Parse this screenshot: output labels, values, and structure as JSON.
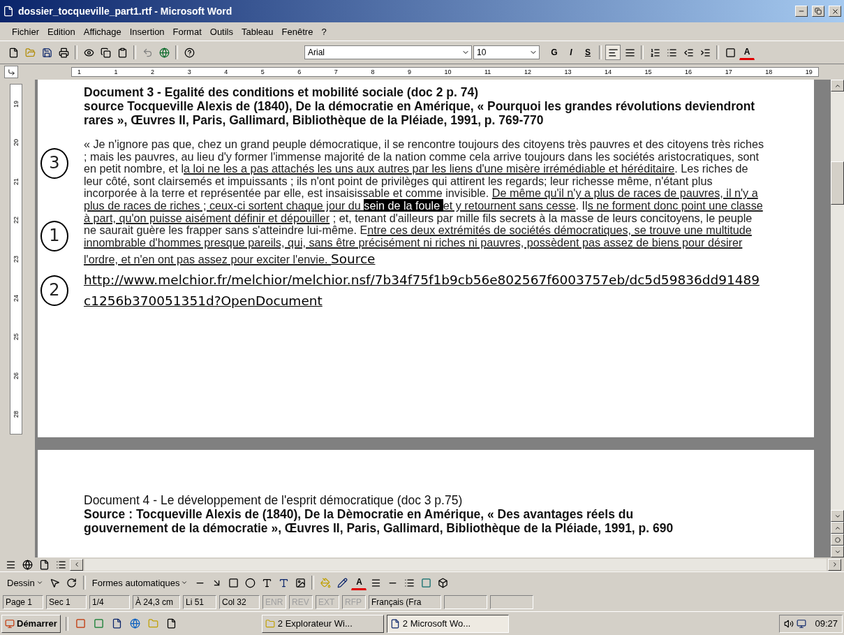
{
  "window": {
    "title": "dossier_tocqueville_part1.rtf - Microsoft Word"
  },
  "menu": [
    "Fichier",
    "Edition",
    "Affichage",
    "Insertion",
    "Format",
    "Outils",
    "Tableau",
    "Fenêtre",
    "?"
  ],
  "toolbar": {
    "font": "Arial",
    "size": "10",
    "format_buttons": [
      "G",
      "I",
      "S"
    ],
    "alignment": [
      {
        "selected": true
      },
      {
        "selected": false
      }
    ],
    "font_color_label": "A"
  },
  "ruler": {
    "marks": [
      "1",
      "1",
      "2",
      "3",
      "4",
      "5",
      "6",
      "7",
      "8",
      "9",
      "10",
      "11",
      "12",
      "13",
      "14",
      "15",
      "16",
      "17",
      "18",
      "19"
    ],
    "vertical_marks": [
      "19",
      "20",
      "21",
      "22",
      "23",
      "24",
      "25",
      "26",
      "28"
    ]
  },
  "page1": {
    "heading": [
      "Document 3 - Egalité des conditions et mobilité sociale (doc 2 p. 74)",
      "source Tocqueville Alexis de (1840), De la démocratie en Amérique, « Pourquoi les grandes révolutions deviendront rares », Œuvres II, Paris, Gallimard, Bibliothèque de la Pléiade, 1991, p. 769-770"
    ],
    "segments": [
      {
        "kind": "plain",
        "text": "« Je n'ignore pas que, chez un grand peuple démocratique, il se rencontre toujours des citoyens très pauvres et des citoyens très riches ; mais les pauvres, au lieu d'y former l'immense majorité de la nation comme cela arrive toujours dans les sociétés aristocratiques, sont en petit nombre, et l"
      },
      {
        "kind": "underlined",
        "text": "a loi ne les a pas attachés les uns aux autres par les liens d'une misère irrémédiable et héréditaire"
      },
      {
        "kind": "plain",
        "text": ". Les riches de leur côté, sont clairsemés et impuissants ; ils n'ont point de privilèges qui attirent les regards; leur richesse même, n'étant plus incorporée à la terre et représentée par elle, est insaisissable et comme invisible. "
      },
      {
        "kind": "underlined",
        "text": "De même qu'il n'y a plus de races de pauvres, il n'y a plus de races de riches ; ceux-ci sortent chaque jour du "
      },
      {
        "kind": "highlighted",
        "text": "sein de la foule "
      },
      {
        "kind": "underlined",
        "text": "et y retournent sans cesse"
      },
      {
        "kind": "plain",
        "text": ". Il"
      },
      {
        "kind": "underlined",
        "text": "s ne forment donc point une classe à part, qu'on puisse aisément définir et dépouiller"
      },
      {
        "kind": "plain",
        "text": " ; et, tenant d'ailleurs par mille fils secrets à la masse de leurs concitoyens, le peuple ne saurait guère les frapper sans s'atteindre lui-même. E"
      },
      {
        "kind": "underlined",
        "text": "ntre ces deux extrémités de sociétés démocratiques, se trouve une multitude innombrable d'hommes presque pareils, qui, sans être précisément ni riches ni pauvres, possèdent pas assez de biens pour désirer l'ordre, et n'en ont pas assez pour exciter l'envie. "
      },
      {
        "kind": "source",
        "text": "Source http://www.melchior.fr/melchior/melchior.nsf/7b34f75f1b9cb56e802567f6003757eb/dc5d59836dd91489c1256b370051351d?OpenDocument"
      }
    ],
    "annotations": [
      "3",
      "1",
      "2"
    ]
  },
  "page2": {
    "heading": [
      "Document 4 -  Le développement de l'esprit démocratique (doc 3 p.75)",
      "Source : Tocqueville Alexis de (1840), De la Dèmocratie en Amérique, « Des avantages réels du",
      "gouvernement de la démocratie », Œuvres II, Paris, Gallimard, Bibliothèque de la Pléiade, 1991, p. 690"
    ]
  },
  "drawing_toolbar": {
    "draw_menu": "Dessin",
    "shapes_menu": "Formes automatiques",
    "font_color_label": "A"
  },
  "status_bar": {
    "fields": [
      "Page 1",
      "Sec 1",
      "1/4",
      "À 24,3 cm",
      "Li 51",
      "Col 32"
    ],
    "modes": [
      {
        "label": "ENR",
        "enabled": false
      },
      {
        "label": "REV",
        "enabled": false
      },
      {
        "label": "EXT",
        "enabled": false
      },
      {
        "label": "RFP",
        "enabled": false
      }
    ],
    "language": "Français (Fra"
  },
  "taskbar": {
    "start": "Démarrer",
    "tasks": [
      {
        "label": "2 Explorateur Wi...",
        "selected": false
      },
      {
        "label": "2 Microsoft Wo...",
        "selected": true
      }
    ],
    "clock": "09:27"
  }
}
